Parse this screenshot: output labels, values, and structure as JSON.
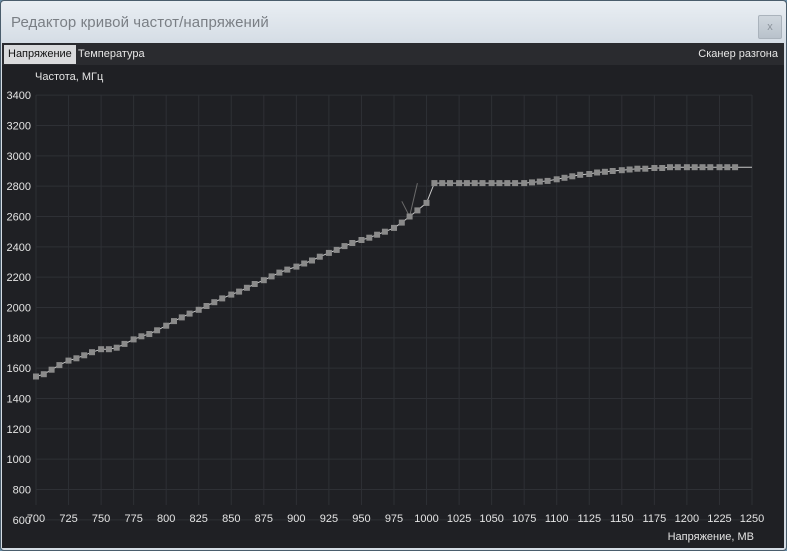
{
  "window": {
    "title": "Редактор кривой частот/напряжений",
    "close_label": "x"
  },
  "tabs": [
    {
      "label": "Напряжение",
      "active": true
    },
    {
      "label": "Температура",
      "active": false
    }
  ],
  "scanner_label": "Сканер разгона",
  "chart_data": {
    "type": "line",
    "ylabel": "Частота, МГц",
    "xlabel": "Напряжение, МВ",
    "xlim": [
      700,
      1250
    ],
    "ylim": [
      500,
      3500
    ],
    "x_ticks": [
      700,
      725,
      750,
      775,
      800,
      825,
      850,
      875,
      900,
      925,
      950,
      975,
      1000,
      1025,
      1050,
      1075,
      1100,
      1125,
      1150,
      1175,
      1200,
      1225,
      1250
    ],
    "y_ticks": [
      600,
      800,
      1000,
      1200,
      1400,
      1600,
      1800,
      2000,
      2200,
      2400,
      2600,
      2800,
      3000,
      3200,
      3400
    ],
    "grid": true,
    "colors": {
      "background": "#1f2024",
      "grid": "#2e3035",
      "line": "#c8c8c8",
      "point": "#8a8a8a"
    },
    "series": [
      {
        "x": [
          700,
          706,
          712,
          718,
          725,
          731,
          737,
          743,
          750,
          756,
          762,
          768,
          775,
          781,
          787,
          793,
          800,
          806,
          812,
          818,
          825,
          831,
          837,
          843,
          850,
          856,
          862,
          868,
          875,
          881,
          887,
          893,
          900,
          906,
          912,
          918,
          925,
          931,
          937,
          943,
          950,
          956,
          962,
          968,
          975,
          981,
          987,
          993,
          1000,
          1006,
          1012,
          1018,
          1025,
          1031,
          1037,
          1043,
          1050,
          1056,
          1062,
          1068,
          1075,
          1081,
          1087,
          1093,
          1100,
          1106,
          1112,
          1118,
          1125,
          1131,
          1137,
          1143,
          1150,
          1156,
          1162,
          1168,
          1175,
          1181,
          1187,
          1193,
          1200,
          1206,
          1212,
          1218,
          1225,
          1231,
          1237,
          1243,
          1250
        ],
        "y": [
          1545,
          1560,
          1590,
          1620,
          1650,
          1665,
          1685,
          1705,
          1725,
          1725,
          1735,
          1760,
          1790,
          1810,
          1825,
          1850,
          1880,
          1910,
          1935,
          1960,
          1985,
          2010,
          2035,
          2060,
          2085,
          2105,
          2130,
          2155,
          2180,
          2205,
          2230,
          2250,
          2270,
          2290,
          2310,
          2335,
          2360,
          2380,
          2405,
          2425,
          2445,
          2460,
          2480,
          2500,
          2525,
          2560,
          2600,
          2640,
          2690,
          2820,
          2820,
          2820,
          2820,
          2820,
          2820,
          2820,
          2820,
          2820,
          2820,
          2820,
          2820,
          2825,
          2830,
          2835,
          2845,
          2855,
          2865,
          2875,
          2880,
          2890,
          2895,
          2900,
          2905,
          2910,
          2915,
          2915,
          2920,
          2920,
          2925,
          2925,
          2925,
          2925,
          2925,
          2925,
          2925,
          2925,
          2925,
          2925,
          2925
        ],
        "points_shown": [
          700,
          706,
          712,
          718,
          725,
          731,
          737,
          743,
          750,
          756,
          762,
          768,
          775,
          781,
          787,
          793,
          800,
          806,
          812,
          818,
          825,
          831,
          837,
          843,
          850,
          856,
          862,
          868,
          875,
          881,
          887,
          893,
          900,
          906,
          912,
          918,
          925,
          931,
          937,
          943,
          950,
          956,
          962,
          968,
          975,
          981,
          987,
          993,
          1000,
          1006,
          1012,
          1018,
          1025,
          1031,
          1037,
          1043,
          1050,
          1056,
          1062,
          1068,
          1075,
          1081,
          1087,
          1093,
          1100,
          1106,
          1112,
          1118,
          1125,
          1131,
          1137,
          1143,
          1150,
          1156,
          1162,
          1168,
          1175,
          1181,
          1187,
          1193,
          1200,
          1206,
          1212,
          1218,
          1225,
          1231,
          1237
        ]
      }
    ]
  }
}
